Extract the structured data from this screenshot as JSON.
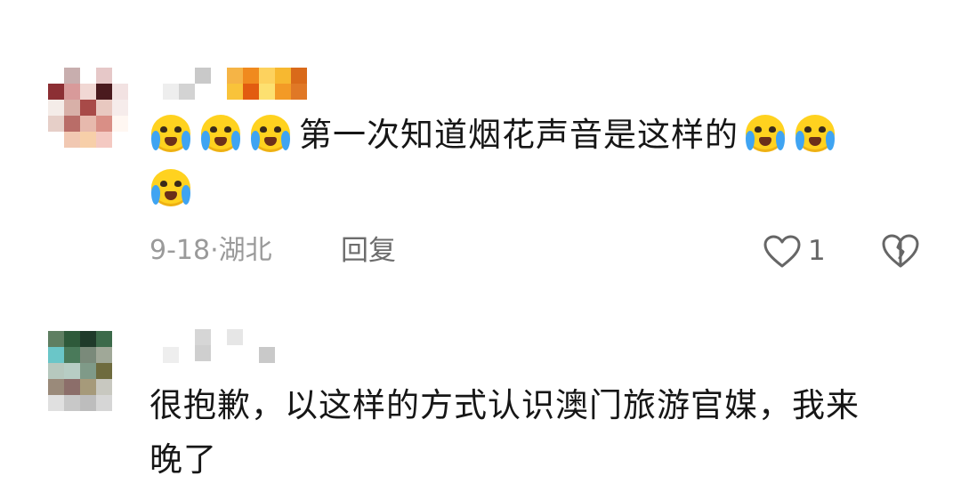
{
  "comments": [
    {
      "text_line1": "第一次知道烟花声音是这样的",
      "date": "9-18",
      "separator": "·",
      "location": "湖北",
      "reply_label": "回复",
      "like_count": "1",
      "leading_emojis": [
        "loudly-crying-icon",
        "loudly-crying-icon",
        "loudly-crying-icon"
      ],
      "trailing_emojis": [
        "loudly-crying-icon",
        "loudly-crying-icon",
        "loudly-crying-icon"
      ]
    },
    {
      "text_line1": "很抱歉，以这样的方式认识澳门旅游官媒，我来",
      "text_line2": "晚了"
    }
  ],
  "colors": {
    "text": "#161616",
    "meta": "#9a9a9a",
    "reply": "#6c6c6c",
    "emoji_face": "#ffd21f",
    "emoji_tear": "#3fa4f2"
  }
}
